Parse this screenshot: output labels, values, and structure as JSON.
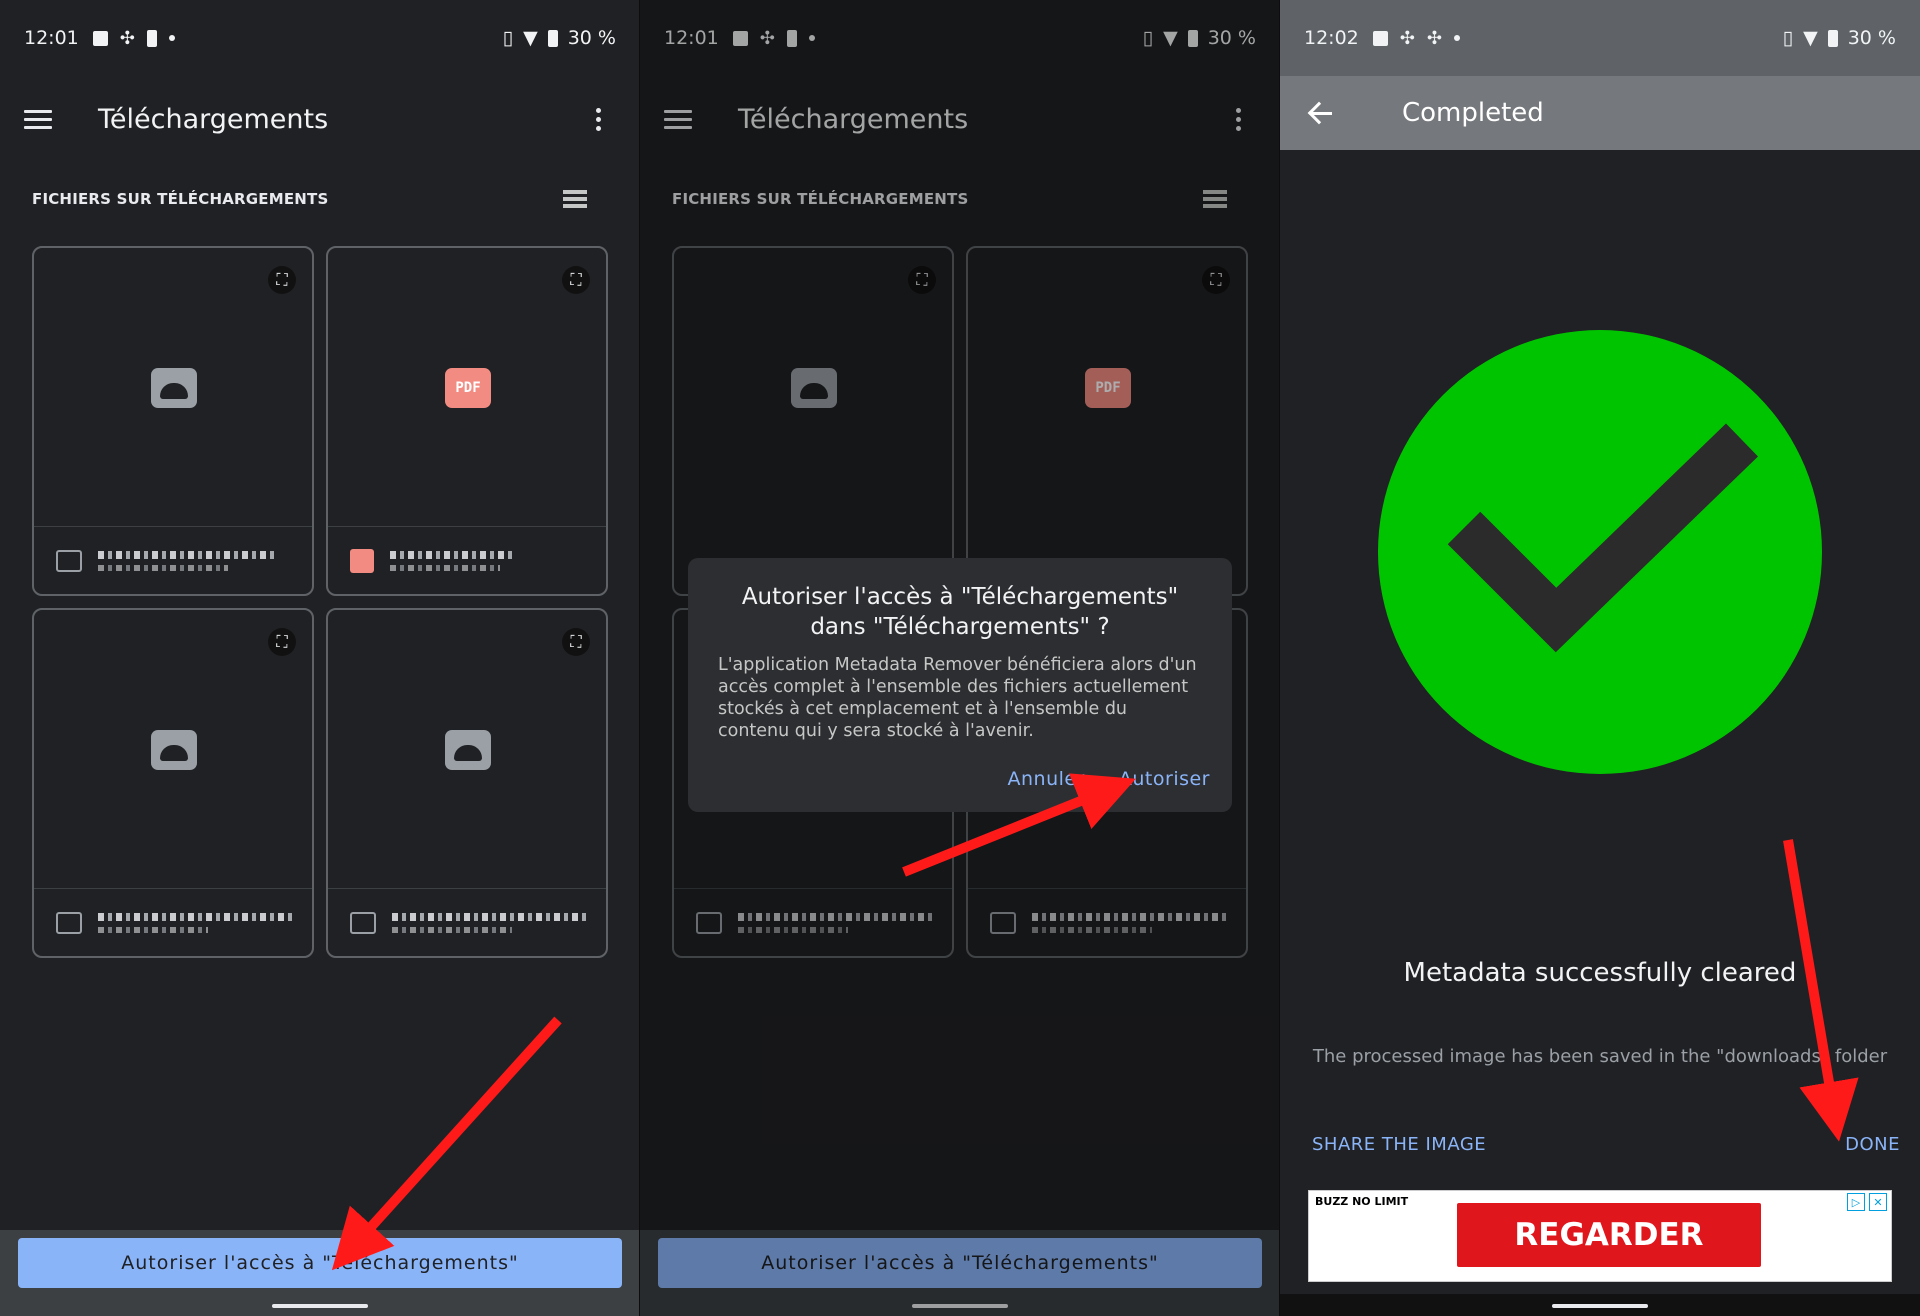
{
  "screen1": {
    "status": {
      "time": "12:01",
      "battery": "30 %"
    },
    "app_title": "Téléchargements",
    "section_label": "FICHIERS SUR TÉLÉCHARGEMENTS",
    "cards": [
      {
        "thumb": "android-icon"
      },
      {
        "thumb": "pdf-icon",
        "label": "PDF"
      },
      {
        "thumb": "android-icon"
      },
      {
        "thumb": "android-icon"
      }
    ],
    "bottom_button": "Autoriser l'accès à \"Téléchargements\""
  },
  "screen2": {
    "status": {
      "time": "12:01",
      "battery": "30 %"
    },
    "app_title": "Téléchargements",
    "section_label": "FICHIERS SUR TÉLÉCHARGEMENTS",
    "pdf_label": "PDF",
    "dialog": {
      "title": "Autoriser l'accès à \"Téléchargements\" dans \"Téléchargements\" ?",
      "body": "L'application Metadata Remover bénéficiera alors d'un accès complet à l'ensemble des fichiers actuellement stockés à cet emplacement et à l'ensemble du contenu qui y sera stocké à l'avenir.",
      "cancel": "Annuler",
      "confirm": "Autoriser"
    },
    "bottom_button": "Autoriser l'accès à \"Téléchargements\""
  },
  "screen3": {
    "status": {
      "time": "12:02",
      "battery": "30 %"
    },
    "title": "Completed",
    "message": "Metadata successfully cleared",
    "subtext": "The processed image has been saved in the \"downloads\" folder",
    "share_label": "SHARE THE IMAGE",
    "done_label": "DONE",
    "ad": {
      "logo": "BUZZ NO LIMIT",
      "cta": "REGARDER"
    },
    "colors": {
      "success": "#00c400",
      "check": "#2b2b2b"
    }
  },
  "colors": {
    "accent": "#8ab4f8",
    "arrow": "#ff1a1a",
    "background": "#202124"
  }
}
